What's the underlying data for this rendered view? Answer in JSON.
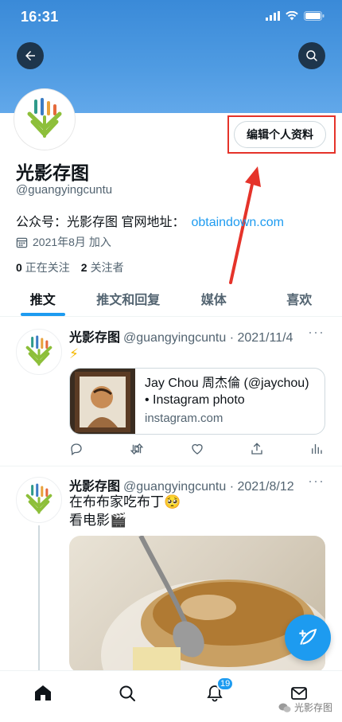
{
  "status": {
    "time": "16:31"
  },
  "profile": {
    "name": "光影存图",
    "handle": "@guangyingcuntu",
    "bio_prefix": "公众号：光影存图 官网地址：",
    "bio_link": "obtaindown.com",
    "joined": "2021年8月 加入",
    "following_count": "0",
    "following_label": "正在关注",
    "followers_count": "2",
    "followers_label": "关注者",
    "edit_button": "编辑个人资料"
  },
  "tabs": [
    "推文",
    "推文和回复",
    "媒体",
    "喜欢"
  ],
  "tweets": [
    {
      "name": "光影存图",
      "meta": "@guangyingcuntu · 2021/11/4",
      "text": "⚡",
      "card": {
        "title_line1": "Jay Chou 周杰倫 (@jaychou)",
        "title_line2": "• Instagram photo",
        "domain": "instagram.com"
      }
    },
    {
      "name": "光影存图",
      "meta": "@guangyingcuntu · 2021/8/12",
      "text_line1": "在布布家吃布丁🥺",
      "text_line2": "看电影🎬"
    }
  ],
  "nav": {
    "notification_badge": "19"
  },
  "watermark": "光影存图",
  "colors": {
    "accent": "#1d9bf0",
    "highlight": "#e5332a",
    "banner": "#3a8ad8"
  },
  "icons": [
    "back-arrow-icon",
    "search-icon",
    "calendar-icon",
    "reply-icon",
    "retweet-icon",
    "like-icon",
    "share-icon",
    "analytics-icon",
    "compose-icon",
    "home-icon",
    "explore-icon",
    "notifications-icon",
    "messages-icon"
  ]
}
